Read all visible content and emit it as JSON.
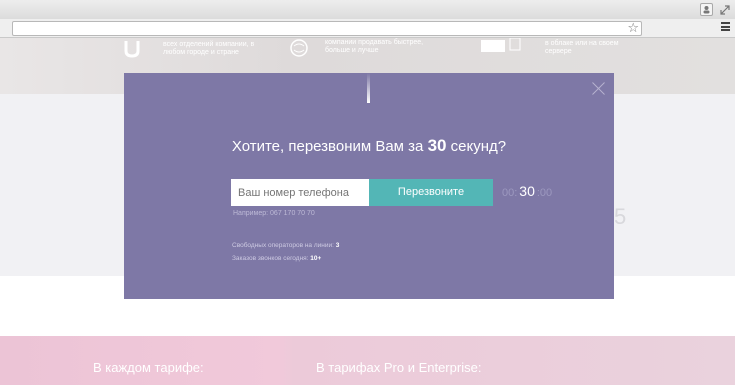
{
  "browser": {
    "url_value": "",
    "icons": [
      "user-icon",
      "fullscreen-icon",
      "star-icon",
      "menu-icon"
    ]
  },
  "background": {
    "feature_texts": [
      "всех отделений компании, в любом городе и стране",
      "компании продавать быстрее, больше и лучше",
      "в облаке или на своем сервере"
    ],
    "pink_titles": [
      "В каждом тарифе:",
      "В тарифах Pro и Enterprise:"
    ]
  },
  "modal": {
    "heading_before": "Хотите, перезвоним Вам за",
    "heading_number": "30",
    "heading_after": "секунд?",
    "phone_placeholder": "Ваш номер телефона",
    "call_button": "Перезвоните",
    "timer": {
      "left": "00:",
      "middle": "30",
      "right": ":00"
    },
    "example": "Например: 067 170 70 70",
    "stats": [
      {
        "label": "Свободных операторов на линии:",
        "value": "3"
      },
      {
        "label": "Заказов звонков сегодня:",
        "value": "10+"
      }
    ]
  },
  "colors": {
    "modal_bg": "#7e78a6",
    "button": "#53b6b6",
    "pink": "#f1c9da"
  }
}
